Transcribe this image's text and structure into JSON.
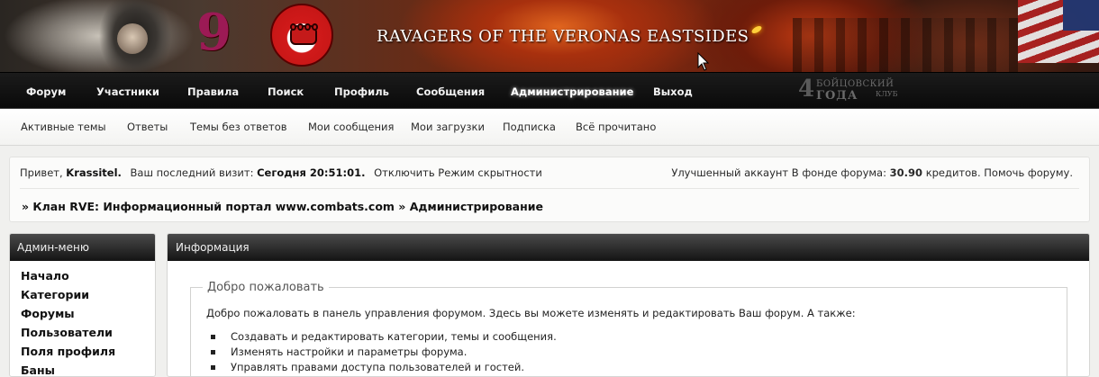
{
  "banner": {
    "title": "RAVAGERS OF THE VERONAS EASTSIDES",
    "clan_number": "9"
  },
  "club_logo": {
    "number": "4",
    "line1": "БОЙЦОВСКИЙ",
    "line2": "ГОДА",
    "line3": "КЛУБ"
  },
  "main_nav": {
    "items": [
      "Форум",
      "Участники",
      "Правила",
      "Поиск",
      "Профиль",
      "Сообщения",
      "Администрирование",
      "Выход"
    ],
    "active": "Администрирование"
  },
  "sub_nav": {
    "items": [
      "Активные темы",
      "Ответы",
      "Темы без ответов",
      "Мои сообщения",
      "Мои загрузки",
      "Подписка",
      "Всё прочитано"
    ]
  },
  "status": {
    "greeting": "Привет,",
    "username": "Krassitel.",
    "last_visit_label": "Ваш последний визит:",
    "last_visit_value": "Сегодня 20:51:01.",
    "stealth_link": "Отключить Режим скрытности",
    "account_type": "Улучшенный аккаунт",
    "fund_label": "В фонде форума:",
    "fund_value": "30.90",
    "fund_unit": "кредитов.",
    "help_link": "Помочь форуму."
  },
  "breadcrumb": {
    "text": "» Клан RVE: Информационный портал www.combats.com » Администрирование"
  },
  "sidebar": {
    "title": "Админ-меню",
    "items": [
      "Начало",
      "Категории",
      "Форумы",
      "Пользователи",
      "Поля профиля",
      "Баны"
    ]
  },
  "info": {
    "title": "Информация",
    "legend": "Добро пожаловать",
    "welcome": "Добро пожаловать в панель управления форумом. Здесь вы можете изменять и редактировать Ваш форум. А также:",
    "bullets": [
      "Создавать и редактировать категории, темы и сообщения.",
      "Изменять настройки и параметры форума.",
      "Управлять правами доступа пользователей и гостей."
    ]
  }
}
